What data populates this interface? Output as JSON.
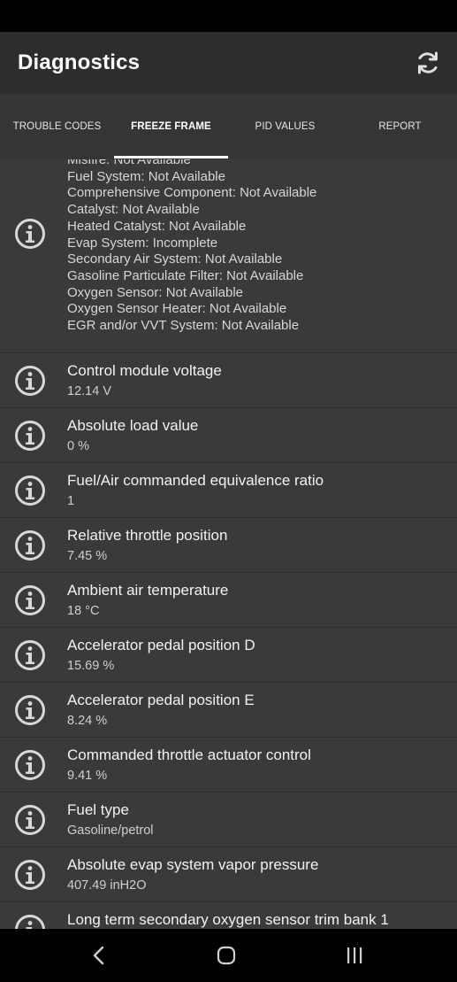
{
  "app": {
    "title": "Diagnostics"
  },
  "tabs": [
    {
      "label": "TROUBLE CODES"
    },
    {
      "label": "FREEZE FRAME"
    },
    {
      "label": "PID VALUES"
    },
    {
      "label": "REPORT"
    }
  ],
  "monitor_block": {
    "lines": [
      "Misfire: Not Available",
      "Fuel System: Not Available",
      "Comprehensive Component: Not Available",
      "Catalyst: Not Available",
      "Heated Catalyst: Not Available",
      "Evap System: Incomplete",
      "Secondary Air System: Not Available",
      "Gasoline Particulate Filter: Not Available",
      "Oxygen Sensor: Not Available",
      "Oxygen Sensor Heater: Not Available",
      "EGR and/or VVT System: Not Available"
    ]
  },
  "items": [
    {
      "title": "Control module voltage",
      "value": "12.14 V"
    },
    {
      "title": "Absolute load value",
      "value": "0 %"
    },
    {
      "title": "Fuel/Air commanded equivalence ratio",
      "value": "1"
    },
    {
      "title": "Relative throttle position",
      "value": "7.45 %"
    },
    {
      "title": "Ambient air temperature",
      "value": "18 °C"
    },
    {
      "title": "Accelerator pedal position D",
      "value": "15.69 %"
    },
    {
      "title": "Accelerator pedal position E",
      "value": "8.24 %"
    },
    {
      "title": "Commanded throttle actuator control",
      "value": "9.41 %"
    },
    {
      "title": "Fuel type",
      "value": "Gasoline/petrol"
    },
    {
      "title": "Absolute evap system vapor pressure",
      "value": "407.49 inH2O"
    },
    {
      "title": "Long term secondary oxygen sensor trim bank 1",
      "value": ""
    }
  ],
  "icons": {
    "refresh": "refresh-icon",
    "info": "info-icon",
    "nav_back": "back-icon",
    "nav_home": "home-icon",
    "nav_recents": "recents-icon"
  },
  "colors": {
    "background": "#3a3a3a",
    "app_bar": "#2d2d2d",
    "tab_bar": "#353535",
    "accent": "#ffffff"
  }
}
